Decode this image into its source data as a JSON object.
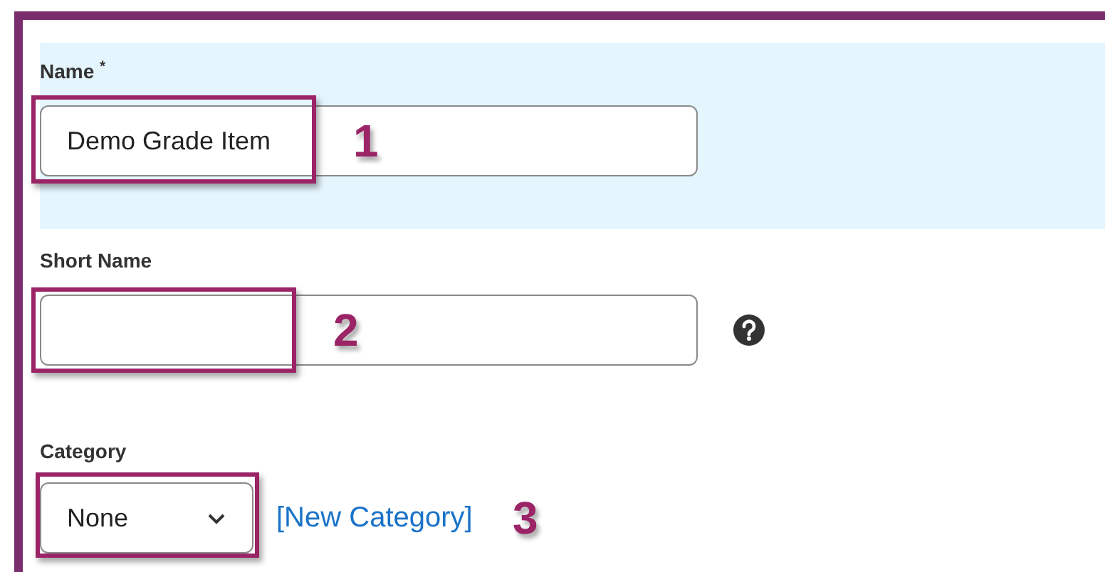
{
  "fields": [
    {
      "kind": "text",
      "label": "Name $^{*}$",
      "highlighted": true,
      "value": "Demo Grade Item",
      "help": false,
      "annotation": "1"
    },
    {
      "kind": "text",
      "label": "Short Name",
      "highlighted": false,
      "help": true,
      "annotation": "2"
    },
    {
      "kind": "select",
      "label": "Category",
      "highlighted": false,
      "value": "None",
      "link": "[New Category]",
      "help": false,
      "annotation": "3"
    }
  ]
}
